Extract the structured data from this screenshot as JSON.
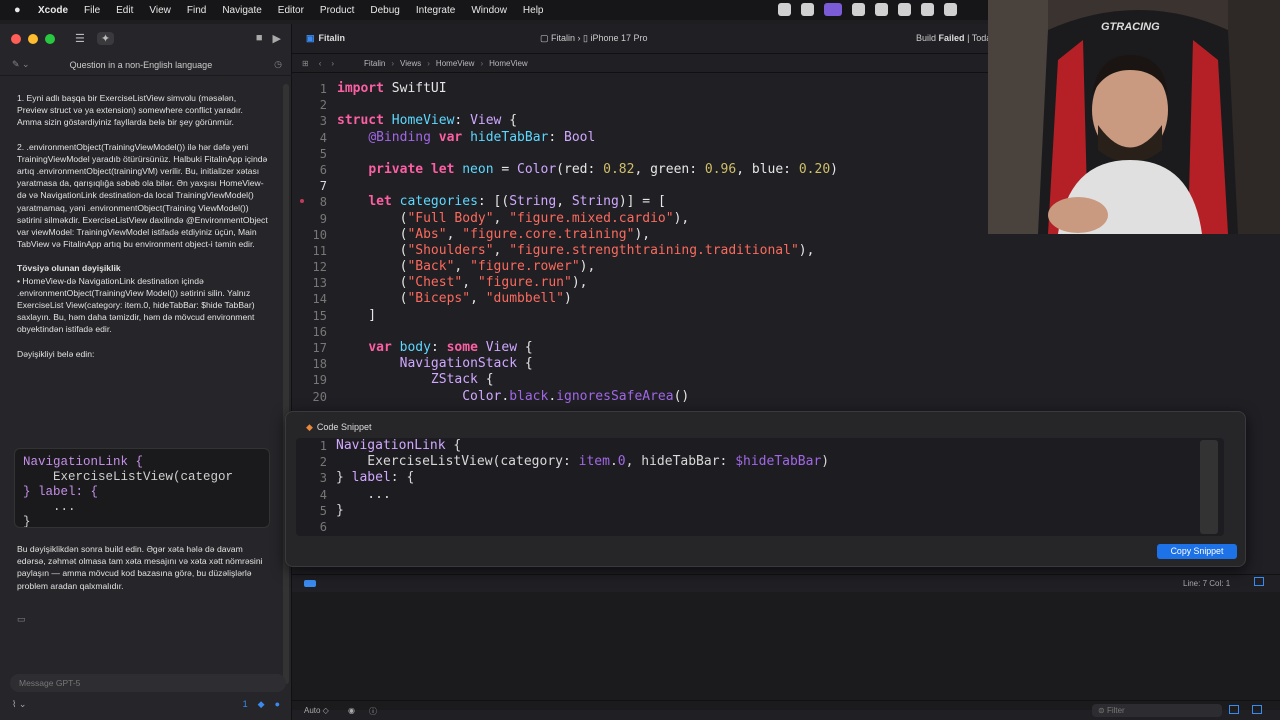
{
  "menubar": {
    "items": [
      "Xcode",
      "File",
      "Edit",
      "View",
      "Find",
      "Navigate",
      "Editor",
      "Product",
      "Debug",
      "Integrate",
      "Window",
      "Help"
    ]
  },
  "assistant": {
    "header_title": "Question in a non-English language",
    "paragraphs": [
      "1. Eyni adlı başqa bir ExerciseListView simvolu (məsələn, Preview struct və ya extension) somewhere conflict yaradır. Amma sizin göstərdiyiniz fayllarda belə bir şey görünmür.",
      "2. .environmentObject(TrainingViewModel()) ilə hər dəfə yeni TrainingViewModel yaradıb ötürürsünüz. Halbuki FitalinApp içində artıq .environmentObject(trainingVM) verilir. Bu, initializer xətası yaratmasa da, qarışıqlığa səbəb ola bilər. Ən yaxşısı HomeView-də və NavigationLink destination-da local TrainingViewModel() yaratmamaq, yəni .environmentObject(Training ViewModel()) sətirini silməkdir. ExerciseListView daxilində @EnvironmentObject var viewModel: TrainingViewModel istifadə etdiyiniz üçün, Main TabView və FitalinApp artıq bu environment object-i təmin edir."
    ],
    "recommendation_title": "Tövsiyə olunan dəyişiklik",
    "recommendation_text": "• HomeView-də NavigationLink destination içində .environmentObject(TrainingView Model()) sətirini silin. Yalnız ExerciseList View(category: item.0, hideTabBar: $hide TabBar) saxlayın. Bu, həm daha təmizdir, həm də mövcud environment obyektindən istifadə edir.",
    "change_prompt": "Dəyişikliyi belə edin:",
    "code_lines": [
      "NavigationLink {",
      "    ExerciseListView(categor",
      "} label: {",
      "    ...",
      "}"
    ],
    "after_text": "Bu dəyişiklikdən sonra build edin. Əgər xəta hələ də davam edərsə, zəhmət olmasa tam xəta mesajını və xəta xətt nömrəsini paylaşın — amma mövcud kod bazasına görə, bu düzəlişlərlə problem aradan qalxmalıdır.",
    "message_placeholder": "Message GPT-5",
    "badge_count": "1"
  },
  "editor": {
    "project": "Fitalin",
    "scheme": "Fitalin",
    "device": "iPhone 17 Pro",
    "build_label": "Build",
    "build_status": "Failed",
    "build_suffix": "| Toda",
    "breadcrumb": [
      "Fitalin",
      "Views",
      "HomeView",
      "HomeView"
    ],
    "line_col": "Line: 7  Col: 1",
    "bottom_mode": "Auto ◇",
    "filter_placeholder": "Filter"
  },
  "code": {
    "line_numbers": [
      "1",
      "2",
      "3",
      "4",
      "5",
      "6",
      "7",
      "8",
      "9",
      "10",
      "11",
      "12",
      "13",
      "14",
      "15",
      "16",
      "17",
      "18",
      "19",
      "20"
    ]
  },
  "snippet": {
    "title": "Code Snippet",
    "copy_label": "Copy Snippet",
    "line_numbers": [
      "1",
      "2",
      "3",
      "4",
      "5",
      "6"
    ]
  },
  "colors": {
    "accent": "#1d72e8",
    "keyword": "#fc5fa3",
    "type": "#5dd8ff",
    "string": "#fc6a5d",
    "number": "#d0bf69"
  }
}
